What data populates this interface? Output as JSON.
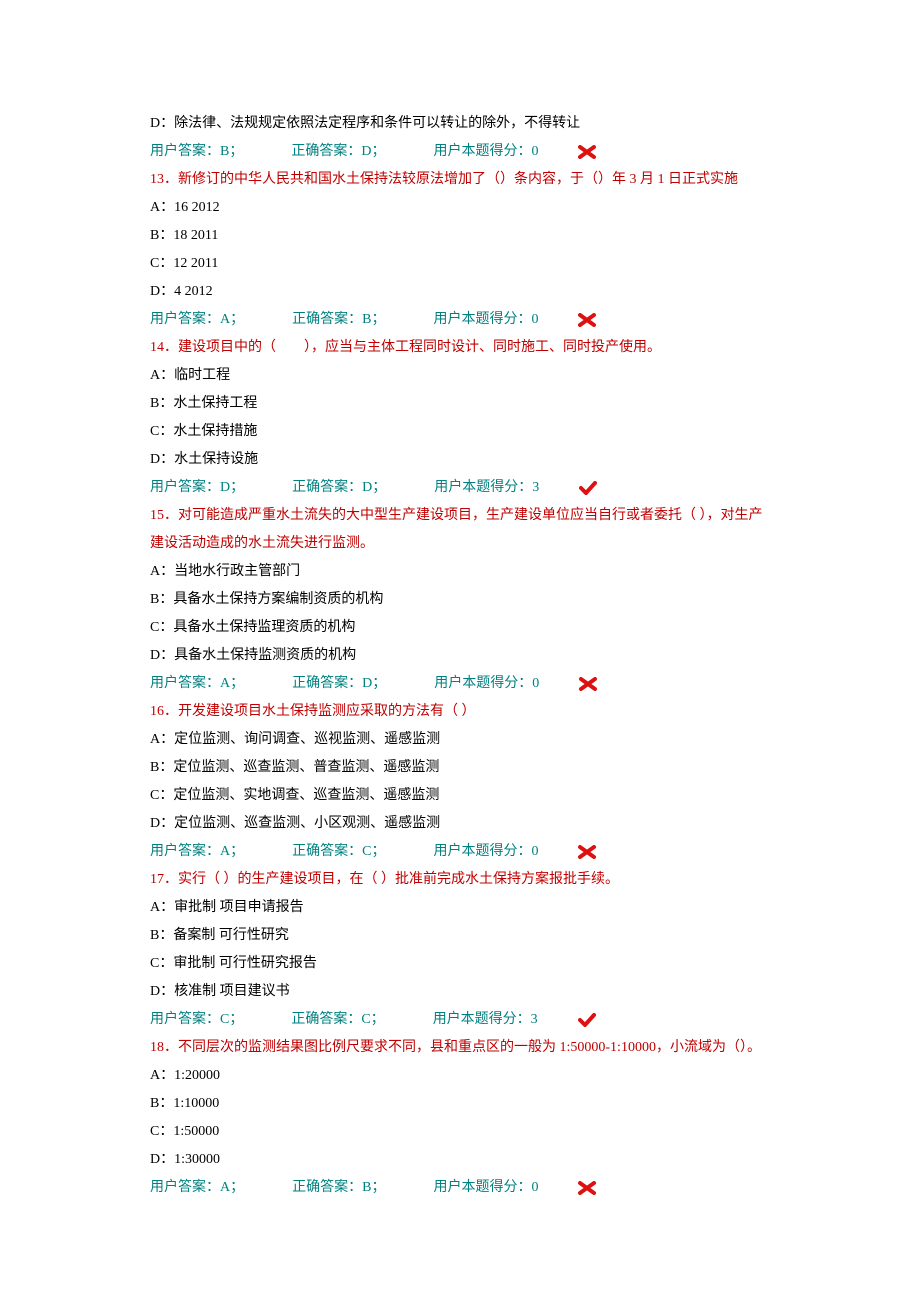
{
  "preD": "D：除法律、法规规定依照法定程序和条件可以转让的除外，不得转让",
  "preResult": {
    "user": "用户答案：B；",
    "correct": "正确答案：D；",
    "score": "用户本题得分：0",
    "icon": "wrong"
  },
  "q13": {
    "text": "13．新修订的中华人民共和国水土保持法较原法增加了（）条内容，于（）年 3 月 1 日正式实施",
    "A": "A：16 2012",
    "B": "B：18 2011",
    "C": "C：12 2011",
    "D": "D：4 2012",
    "result": {
      "user": "用户答案：A；",
      "correct": "正确答案：B；",
      "score": "用户本题得分：0",
      "icon": "wrong"
    }
  },
  "q14": {
    "text": "14．建设项目中的（　　），应当与主体工程同时设计、同时施工、同时投产使用。",
    "A": "A：临时工程",
    "B": "B：水土保持工程",
    "C": "C：水土保持措施",
    "D": "D：水土保持设施",
    "result": {
      "user": "用户答案：D；",
      "correct": "正确答案：D；",
      "score": "用户本题得分：3",
      "icon": "right"
    }
  },
  "q15": {
    "text": "15．对可能造成严重水土流失的大中型生产建设项目，生产建设单位应当自行或者委托（ ），对生产建设活动造成的水土流失进行监测。",
    "A": "A：当地水行政主管部门",
    "B": "B：具备水土保持方案编制资质的机构",
    "C": "C：具备水土保持监理资质的机构",
    "D": "D：具备水土保持监测资质的机构",
    "result": {
      "user": "用户答案：A；",
      "correct": "正确答案：D；",
      "score": "用户本题得分：0",
      "icon": "wrong"
    }
  },
  "q16": {
    "text": "16．开发建设项目水土保持监测应采取的方法有（ ）",
    "A": "A：定位监测、询问调查、巡视监测、遥感监测",
    "B": "B：定位监测、巡查监测、普查监测、遥感监测",
    "C": "C：定位监测、实地调查、巡查监测、遥感监测",
    "D": "D：定位监测、巡查监测、小区观测、遥感监测",
    "result": {
      "user": "用户答案：A；",
      "correct": "正确答案：C；",
      "score": "用户本题得分：0",
      "icon": "wrong"
    }
  },
  "q17": {
    "text": "17．实行（ ）的生产建设项目，在（ ）批准前完成水土保持方案报批手续。",
    "A": "A：审批制 项目申请报告",
    "B": "B：备案制 可行性研究",
    "C": "C：审批制 可行性研究报告",
    "D": "D：核准制 项目建议书",
    "result": {
      "user": "用户答案：C；",
      "correct": "正确答案：C；",
      "score": "用户本题得分：3",
      "icon": "right"
    }
  },
  "q18": {
    "text": "18．不同层次的监测结果图比例尺要求不同，县和重点区的一般为 1:50000-1:10000，小流域为（）。",
    "A": "A：1:20000",
    "B": "B：1:10000",
    "C": "C：1:50000",
    "D": "D：1:30000",
    "result": {
      "user": "用户答案：A；",
      "correct": "正确答案：B；",
      "score": "用户本题得分：0",
      "icon": "wrong"
    }
  }
}
